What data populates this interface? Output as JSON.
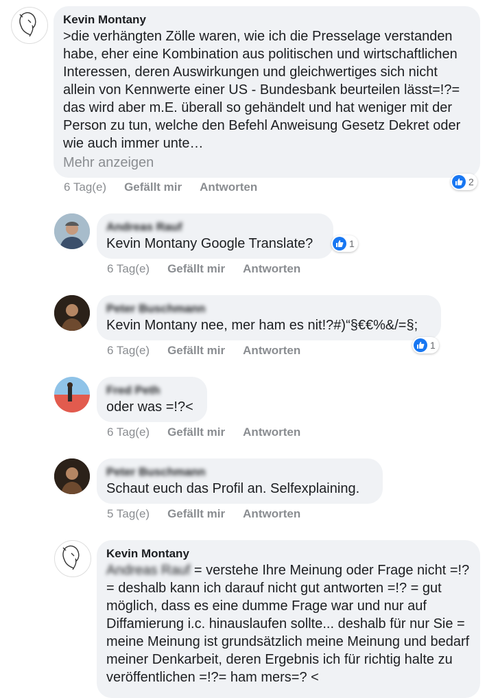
{
  "comments": [
    {
      "author": "Kevin Montany",
      "text": ">die verhängten Zölle waren, wie ich die Presselage verstanden habe, eher eine Kombination aus politischen und wirtschaftlichen Interessen, deren Auswirkungen und gleichwertiges sich nicht  allein von Kennwerte einer US - Bundesbank  beurteilen lässt=!?= das wird aber m.E. überall so gehändelt und hat weniger mit der Person zu tun, welche den Befehl Anweisung Gesetz Dekret oder wie auch immer unte…",
      "more": "Mehr anzeigen",
      "time": "6 Tag(e)",
      "like": "Gefällt mir",
      "reply": "Antworten",
      "reactions": "2"
    },
    {
      "author": "Andreas Rauf",
      "text": "Kevin Montany Google Translate?",
      "time": "6 Tag(e)",
      "like": "Gefällt mir",
      "reply": "Antworten",
      "reactions": "1"
    },
    {
      "author": "Peter Buschmann",
      "text": "Kevin Montany nee, mer ham es nit!?#)“§€€%&/=§;",
      "time": "6 Tag(e)",
      "like": "Gefällt mir",
      "reply": "Antworten",
      "reactions": "1"
    },
    {
      "author": "Fred Peth",
      "text": "oder was =!?<",
      "time": "6 Tag(e)",
      "like": "Gefällt mir",
      "reply": "Antworten"
    },
    {
      "author": "Peter Buschmann",
      "text": "Schaut euch das Profil an. Selfexplaining.",
      "time": "5 Tag(e)",
      "like": "Gefällt mir",
      "reply": "Antworten"
    },
    {
      "author": "Kevin Montany",
      "mention": "Andreas Rauf",
      "text": " = verstehe Ihre Meinung oder Frage nicht =!? = deshalb kann ich darauf nicht gut antworten =!? = gut möglich, dass es eine dumme Frage war und nur auf Diffamierung i.c. hinauslaufen sollte... deshalb für nur Sie =  meine Meinung ist grundsätzlich meine Meinung und bedarf meiner Denkarbeit, deren Ergebnis ich für richtig halte zu veröffentlichen =!?= ham mers=? <"
    }
  ],
  "colors": {
    "like_blue": "#1877f2",
    "bubble": "#f0f2f5",
    "meta": "#8a8d91"
  }
}
